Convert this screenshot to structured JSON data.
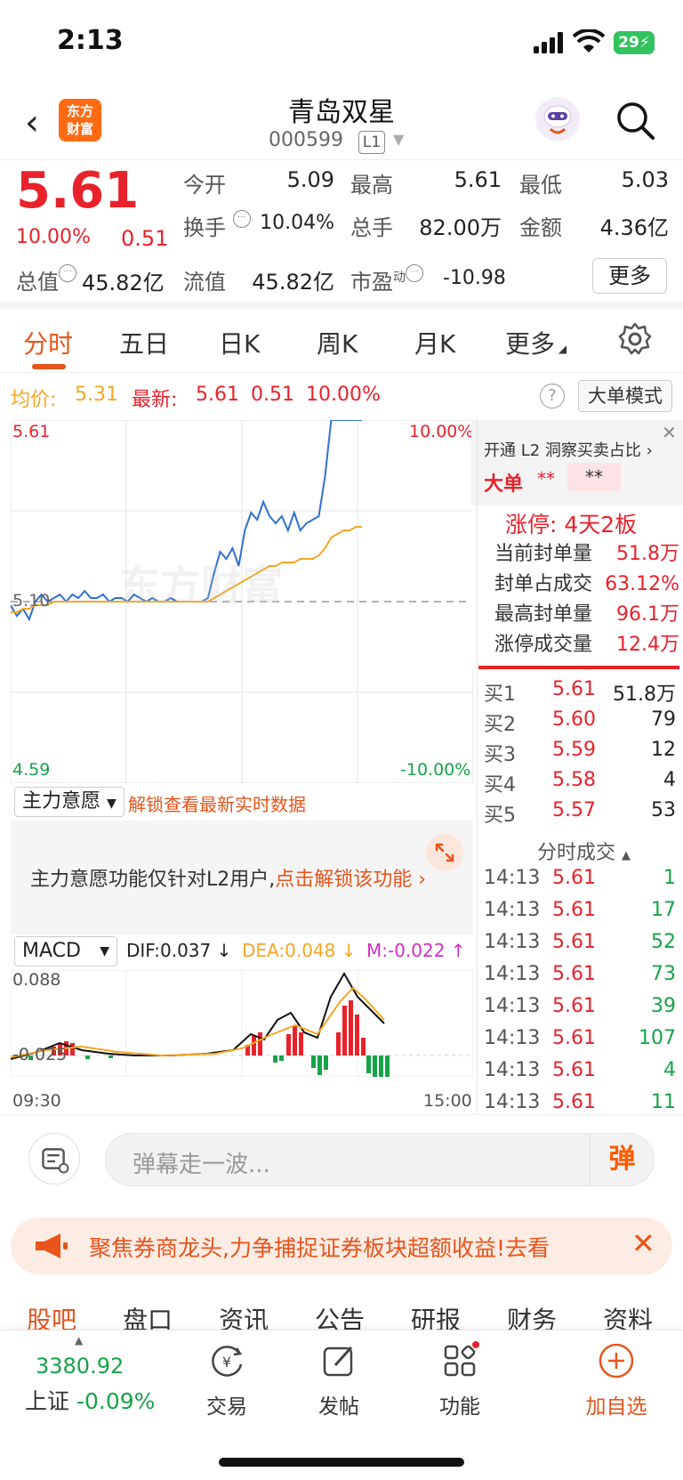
{
  "status_bar": {
    "time": "2:13",
    "battery": "29"
  },
  "nav": {
    "logo_line1": "东方",
    "logo_line2": "财富",
    "stock_name": "青岛双星",
    "stock_code": "000599",
    "level_badge": "L1"
  },
  "quote": {
    "price": "5.61",
    "change_pct": "10.00%",
    "change": "0.51",
    "rows": [
      [
        {
          "label": "今开",
          "value": "5.09",
          "color": "green"
        },
        {
          "label": "最高",
          "value": "5.61",
          "color": "red"
        },
        {
          "label": "最低",
          "value": "5.03",
          "color": "green"
        }
      ],
      [
        {
          "label": "换手",
          "value": "10.04%",
          "color": "normal"
        },
        {
          "label": "总手",
          "value": "82.00万",
          "color": "normal"
        },
        {
          "label": "金额",
          "value": "4.36亿",
          "color": "normal"
        }
      ]
    ],
    "total_value_label": "总值",
    "total_value": "45.82亿",
    "float_value_label": "流值",
    "float_value": "45.82亿",
    "pe_label": "市盈",
    "pe_sup": "动",
    "pe_value": "-10.98",
    "more_button": "更多"
  },
  "tabs": [
    "分时",
    "五日",
    "日K",
    "周K",
    "月K",
    "更多"
  ],
  "info_line": {
    "avg_label": "均价:",
    "avg_value": "5.31",
    "latest_label": "最新:",
    "latest_value": "5.61",
    "latest_change": "0.51",
    "latest_pct": "10.00%",
    "help": "?",
    "mode_button": "大单模式"
  },
  "chart_labels": {
    "y_top": "5.61",
    "y_mid": "5.10",
    "y_bottom": "4.59",
    "pct_top": "10.00%",
    "pct_bottom": "-10.00%",
    "watermark": "东方财富"
  },
  "chart_data": {
    "type": "line",
    "x_range": [
      "09:30",
      "15:00"
    ],
    "ylim": [
      4.59,
      5.61
    ],
    "series": [
      {
        "color": "#2f6fd1",
        "values": [
          5.09,
          5.06,
          5.08,
          5.05,
          5.1,
          5.12,
          5.1,
          5.11,
          5.12,
          5.1,
          5.12,
          5.11,
          5.13,
          5.11,
          5.11,
          5.12,
          5.1,
          5.11,
          5.11,
          5.1,
          5.12,
          5.11,
          5.1,
          5.11,
          5.1,
          5.1,
          5.11,
          5.1,
          5.1,
          5.1,
          5.1,
          5.1,
          5.11,
          5.18,
          5.24,
          5.22,
          5.25,
          5.2,
          5.3,
          5.35,
          5.33,
          5.38,
          5.34,
          5.32,
          5.34,
          5.3,
          5.35,
          5.3,
          5.32,
          5.33,
          5.34,
          5.45,
          5.61,
          5.61,
          5.61,
          5.61,
          5.61,
          5.61
        ]
      },
      {
        "color": "#f5a623",
        "values": [
          5.07,
          5.07,
          5.08,
          5.08,
          5.09,
          5.09,
          5.09,
          5.1,
          5.1,
          5.1,
          5.1,
          5.1,
          5.1,
          5.1,
          5.1,
          5.1,
          5.1,
          5.1,
          5.1,
          5.1,
          5.1,
          5.1,
          5.1,
          5.1,
          5.1,
          5.1,
          5.1,
          5.1,
          5.1,
          5.1,
          5.1,
          5.1,
          5.1,
          5.11,
          5.12,
          5.13,
          5.14,
          5.15,
          5.16,
          5.17,
          5.18,
          5.19,
          5.2,
          5.2,
          5.21,
          5.21,
          5.21,
          5.22,
          5.22,
          5.22,
          5.23,
          5.25,
          5.28,
          5.29,
          5.3,
          5.3,
          5.31,
          5.31
        ]
      }
    ]
  },
  "l2": {
    "promo": "开通 L2 洞察买卖占比",
    "big_order_label": "大单",
    "mask1": "**",
    "mask2": "**",
    "limit_title": "涨停: 4天2板",
    "limit_rows": [
      {
        "label": "当前封单量",
        "value": "51.8万"
      },
      {
        "label": "封单占成交",
        "value": "63.12%"
      },
      {
        "label": "最高封单量",
        "value": "96.1万"
      },
      {
        "label": "涨停成交量",
        "value": "12.4万"
      }
    ]
  },
  "order_book": [
    {
      "label": "买1",
      "price": "5.61",
      "volume": "51.8万"
    },
    {
      "label": "买2",
      "price": "5.60",
      "volume": "79"
    },
    {
      "label": "买3",
      "price": "5.59",
      "volume": "12"
    },
    {
      "label": "买4",
      "price": "5.58",
      "volume": "4"
    },
    {
      "label": "买5",
      "price": "5.57",
      "volume": "53"
    }
  ],
  "trades_title": "分时成交",
  "trades": [
    {
      "time": "14:13",
      "price": "5.61",
      "volume": "1"
    },
    {
      "time": "14:13",
      "price": "5.61",
      "volume": "17"
    },
    {
      "time": "14:13",
      "price": "5.61",
      "volume": "52"
    },
    {
      "time": "14:13",
      "price": "5.61",
      "volume": "73"
    },
    {
      "time": "14:13",
      "price": "5.61",
      "volume": "39"
    },
    {
      "time": "14:13",
      "price": "5.61",
      "volume": "107"
    },
    {
      "time": "14:13",
      "price": "5.61",
      "volume": "4"
    },
    {
      "time": "14:13",
      "price": "5.61",
      "volume": "11"
    }
  ],
  "intent": {
    "dropdown": "主力意愿",
    "unlock_link": "解锁查看最新实时数据",
    "notice": "主力意愿功能仅针对L2用户,",
    "notice_link": "点击解锁该功能"
  },
  "macd": {
    "dropdown": "MACD",
    "dif": "DIF:0.037 ↓",
    "dea": "DEA:0.048 ↓",
    "m": "M:-0.022 ↑",
    "y_top": "0.088",
    "y_bottom": "-0.025",
    "x_start": "09:30",
    "x_end": "15:00"
  },
  "comment": {
    "placeholder": "弹幕走一波...",
    "danmu": "弹"
  },
  "banner": {
    "text": "聚焦券商龙头,力争捕捉证券板块超额收益!去看"
  },
  "sub_tabs": [
    "股吧",
    "盘口",
    "资讯",
    "公告",
    "研报",
    "财务",
    "资料"
  ],
  "bottom_bar": {
    "index_value": "3380.92",
    "index_name": "上证",
    "index_change": "-0.09%",
    "items": [
      "交易",
      "发帖",
      "功能",
      "加自选"
    ]
  }
}
